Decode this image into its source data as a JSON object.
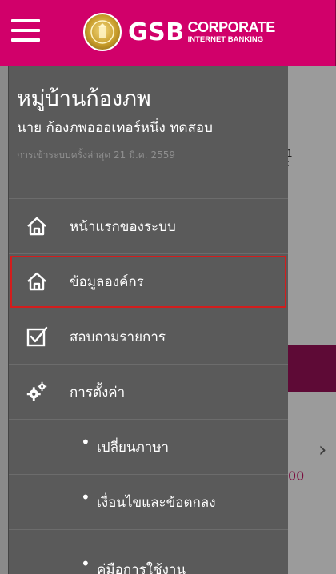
{
  "header": {
    "logo_main": "GSB",
    "logo_sub_1": "CORPORATE",
    "logo_sub_2": "INTERNET BANKING",
    "menu_icon": "hamburger-icon"
  },
  "profile": {
    "organization": "หมู่บ้านก้องภพ",
    "user_name": "นาย ก้องภพอออเทอร์หนึ่ง ทดสอบ",
    "last_login": "การเข้าระบบครั้งล่าสุด 21 มี.ค. 2559"
  },
  "menu": [
    {
      "label": "หน้าแรกของระบบ",
      "icon": "home-icon"
    },
    {
      "label": "ข้อมูลองค์กร",
      "icon": "home-icon",
      "highlighted": true
    },
    {
      "label": "สอบถามรายการ",
      "icon": "checkbox-icon"
    },
    {
      "label": "การตั้งค่า",
      "icon": "gears-icon"
    }
  ],
  "settings_submenu": [
    {
      "label": "เปลี่ยนภาษา"
    },
    {
      "label": "เงื่อนไขและข้อตกลง"
    },
    {
      "label": "คู่มือการใช้งาน"
    }
  ],
  "background": {
    "amount_fragment": "00",
    "chevron": "›"
  },
  "colors": {
    "header_bg": "#d1006a",
    "drawer_bg": "#5a5a5a",
    "highlight_border": "#d21d1d"
  }
}
